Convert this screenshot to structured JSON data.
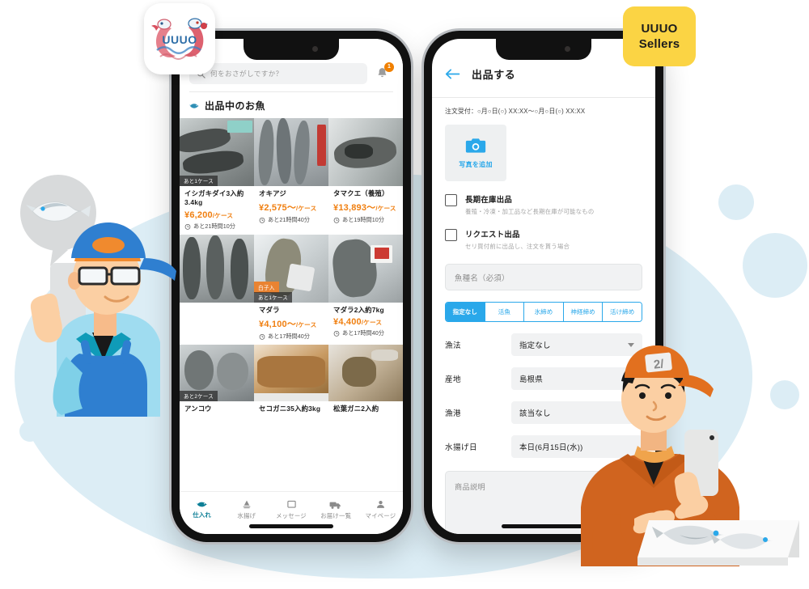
{
  "brand": {
    "app_logo_text": "UUUO",
    "sellers_badge_line1": "UUUO",
    "sellers_badge_line2": "Sellers",
    "accent_blue": "#2aa8ea",
    "accent_orange": "#f07f10",
    "accent_yellow": "#fbd444",
    "teal": "#0e7f96",
    "bg_blue": "#dcedf5"
  },
  "buyer_app": {
    "search": {
      "placeholder": "何をおさがしですか？",
      "icon": "search-icon"
    },
    "notification": {
      "icon": "bell-icon",
      "count": "1"
    },
    "section": {
      "icon": "fish-icon",
      "title": "出品中のお魚"
    },
    "products": [
      {
        "name": "イシガキダイ3入約3.4kg",
        "price": "¥6,200",
        "unit": "/ケース",
        "time": "あと21時間10分",
        "ribbon": "あと1ケース",
        "tag": ""
      },
      {
        "name": "オキアジ",
        "price": "¥2,575〜",
        "unit": "/ケース",
        "time": "あと21時間40分",
        "ribbon": "",
        "tag": ""
      },
      {
        "name": "タマクエ（養殖）",
        "price": "¥13,893〜",
        "unit": "/ケース",
        "time": "あと19時間10分",
        "ribbon": "",
        "tag": ""
      },
      {
        "name": "マダラ",
        "price": "¥4,100〜",
        "unit": "/ケース",
        "time": "あと17時間40分",
        "ribbon": "あと1ケース",
        "tag": "白子入"
      },
      {
        "name": "マダラ2入約7kg",
        "price": "¥4,400",
        "unit": "/ケース",
        "time": "あと17時間40分",
        "ribbon": "",
        "tag": ""
      },
      {
        "name": "アンコウ",
        "price": "",
        "unit": "",
        "time": "",
        "ribbon": "あと2ケース",
        "tag": ""
      },
      {
        "name": "セコガニ35入約3kg",
        "price": "",
        "unit": "",
        "time": "",
        "ribbon": "",
        "tag": ""
      },
      {
        "name": "松葉ガニ2入約",
        "price": "",
        "unit": "",
        "time": "",
        "ribbon": "",
        "tag": ""
      }
    ],
    "tabs": [
      {
        "label": "仕入れ",
        "icon": "fish-icon",
        "active": true
      },
      {
        "label": "水揚げ",
        "icon": "boat-icon",
        "active": false
      },
      {
        "label": "メッセージ",
        "icon": "chat-icon",
        "active": false
      },
      {
        "label": "お届け一覧",
        "icon": "truck-icon",
        "active": false
      },
      {
        "label": "マイページ",
        "icon": "person-icon",
        "active": false
      }
    ]
  },
  "seller_app": {
    "header": {
      "back_icon": "back-arrow-icon",
      "title": "出品する"
    },
    "order_note": "注文受付：○月○日(○) XX:XX〜○月○日(○) XX:XX",
    "photo_add": {
      "icon": "camera-icon",
      "label": "写真を追加"
    },
    "checkboxes": [
      {
        "title": "長期在庫出品",
        "subtitle": "養殖・冷凍・加工品など長期在庫が可能なもの",
        "checked": false
      },
      {
        "title": "リクエスト出品",
        "subtitle": "セリ買付前に出品し、注文を貰う場合",
        "checked": false
      }
    ],
    "species_field": {
      "placeholder": "魚種名（必須）",
      "value": ""
    },
    "segments": [
      {
        "label": "指定なし",
        "selected": true
      },
      {
        "label": "活魚",
        "selected": false
      },
      {
        "label": "氷締め",
        "selected": false
      },
      {
        "label": "神経締め",
        "selected": false
      },
      {
        "label": "活け締め",
        "selected": false
      }
    ],
    "fields": [
      {
        "label": "漁法",
        "value": "指定なし"
      },
      {
        "label": "産地",
        "value": "島根県"
      },
      {
        "label": "漁港",
        "value": "該当なし"
      },
      {
        "label": "水揚げ日",
        "value": "本日(6月15日(水))"
      }
    ],
    "description_field": {
      "placeholder": "商品説明",
      "value": ""
    }
  }
}
